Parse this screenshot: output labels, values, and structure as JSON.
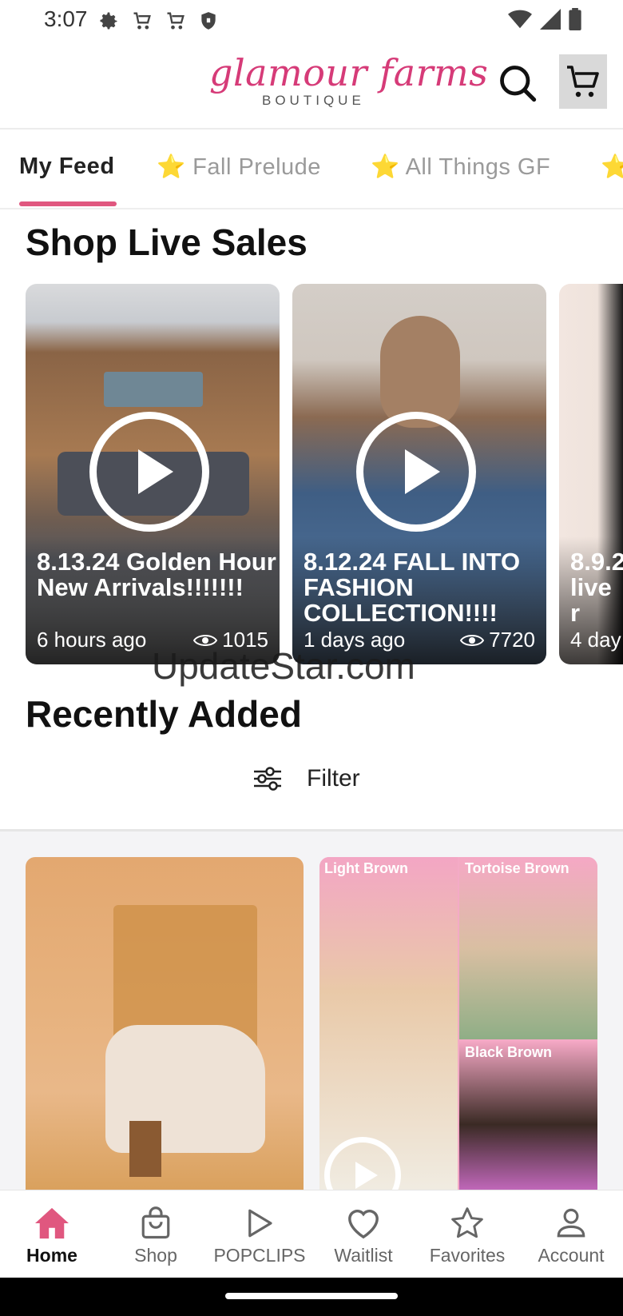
{
  "status_bar": {
    "time": "3:07",
    "icons": [
      "gear-icon",
      "cart-icon",
      "cart-icon",
      "shield-icon"
    ],
    "right_icons": [
      "wifi-icon",
      "signal-icon",
      "battery-icon"
    ]
  },
  "header": {
    "logo_text": "glamour farms",
    "logo_sub": "BOUTIQUE",
    "search_icon": "search-icon",
    "cart_icon": "cart-icon"
  },
  "tabs": [
    {
      "label": "My Feed",
      "active": true
    },
    {
      "label": "⭐ Fall Prelude",
      "active": false
    },
    {
      "label": "⭐ All Things GF",
      "active": false
    },
    {
      "label": "⭐",
      "active": false
    }
  ],
  "live_sales": {
    "title": "Shop Live Sales",
    "cards": [
      {
        "title": "8.13.24 Golden Hour New Arrivals!!!!!!!",
        "time": "6 hours ago",
        "views": "1015"
      },
      {
        "title": "8.12.24 FALL INTO FASHION COLLECTION!!!!",
        "time": "1 days ago",
        "views": "7720"
      },
      {
        "title": "8.9.2 live r",
        "time": "4 day",
        "views": ""
      }
    ]
  },
  "watermark": "UpdateStar.com",
  "recently_added": {
    "title": "Recently Added",
    "filter_label": "Filter",
    "products": [
      {
        "alt": "cream ankle boot"
      },
      {
        "labels": [
          "Light Brown",
          "Tortoise Brown",
          "Black Brown"
        ]
      }
    ]
  },
  "bottom_nav": [
    {
      "label": "Home",
      "icon": "home-icon",
      "active": true
    },
    {
      "label": "Shop",
      "icon": "shopping-bag-icon",
      "active": false
    },
    {
      "label": "POPCLIPS",
      "icon": "play-icon",
      "active": false
    },
    {
      "label": "Waitlist",
      "icon": "heart-icon",
      "active": false
    },
    {
      "label": "Favorites",
      "icon": "star-icon",
      "active": false
    },
    {
      "label": "Account",
      "icon": "person-icon",
      "active": false
    }
  ],
  "colors": {
    "brand_pink": "#d63b78",
    "tab_underline": "#e0577f",
    "nav_active": "#e0577f"
  }
}
